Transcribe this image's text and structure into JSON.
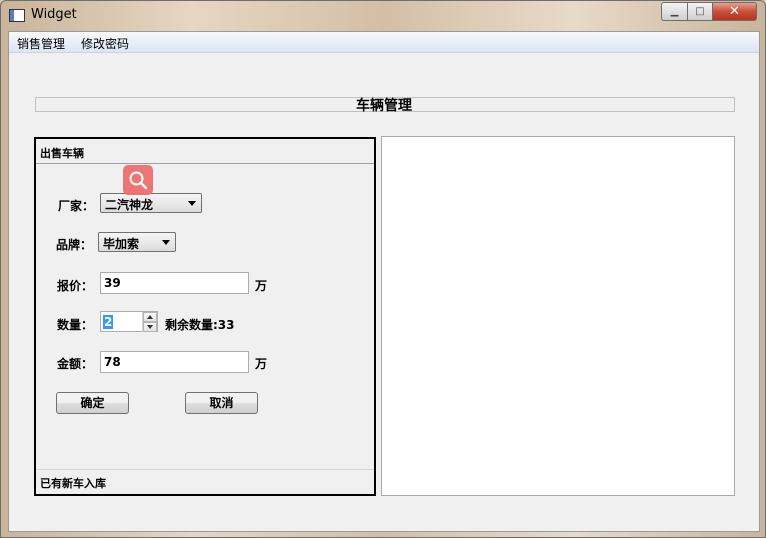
{
  "window": {
    "title": "Widget",
    "close_glyph": "✕",
    "minimize_glyph": "▁",
    "maximize_glyph": "□"
  },
  "menubar": {
    "items": [
      "销售管理",
      "修改密码"
    ]
  },
  "heading": "车辆管理",
  "sale_panel": {
    "title": "出售车辆",
    "manufacturer": {
      "label": "厂家：",
      "value": "二汽神龙"
    },
    "brand": {
      "label": "品牌：",
      "value": "毕加索"
    },
    "price": {
      "label": "报价：",
      "value": "39",
      "unit": "万"
    },
    "quantity": {
      "label": "数量：",
      "value": "2",
      "remaining": "剩余数量:33"
    },
    "amount": {
      "label": "金额：",
      "value": "78",
      "unit": "万"
    },
    "confirm_label": "确定",
    "cancel_label": "取消",
    "footer": "已有新车入库"
  },
  "colors": {
    "search_badge": "#ee6f6f",
    "selection": "#3399ff"
  },
  "icons": [
    "app-icon",
    "search-icon",
    "minimize-icon",
    "maximize-icon",
    "close-icon",
    "dropdown-arrow-icon",
    "spin-up-icon",
    "spin-down-icon"
  ]
}
